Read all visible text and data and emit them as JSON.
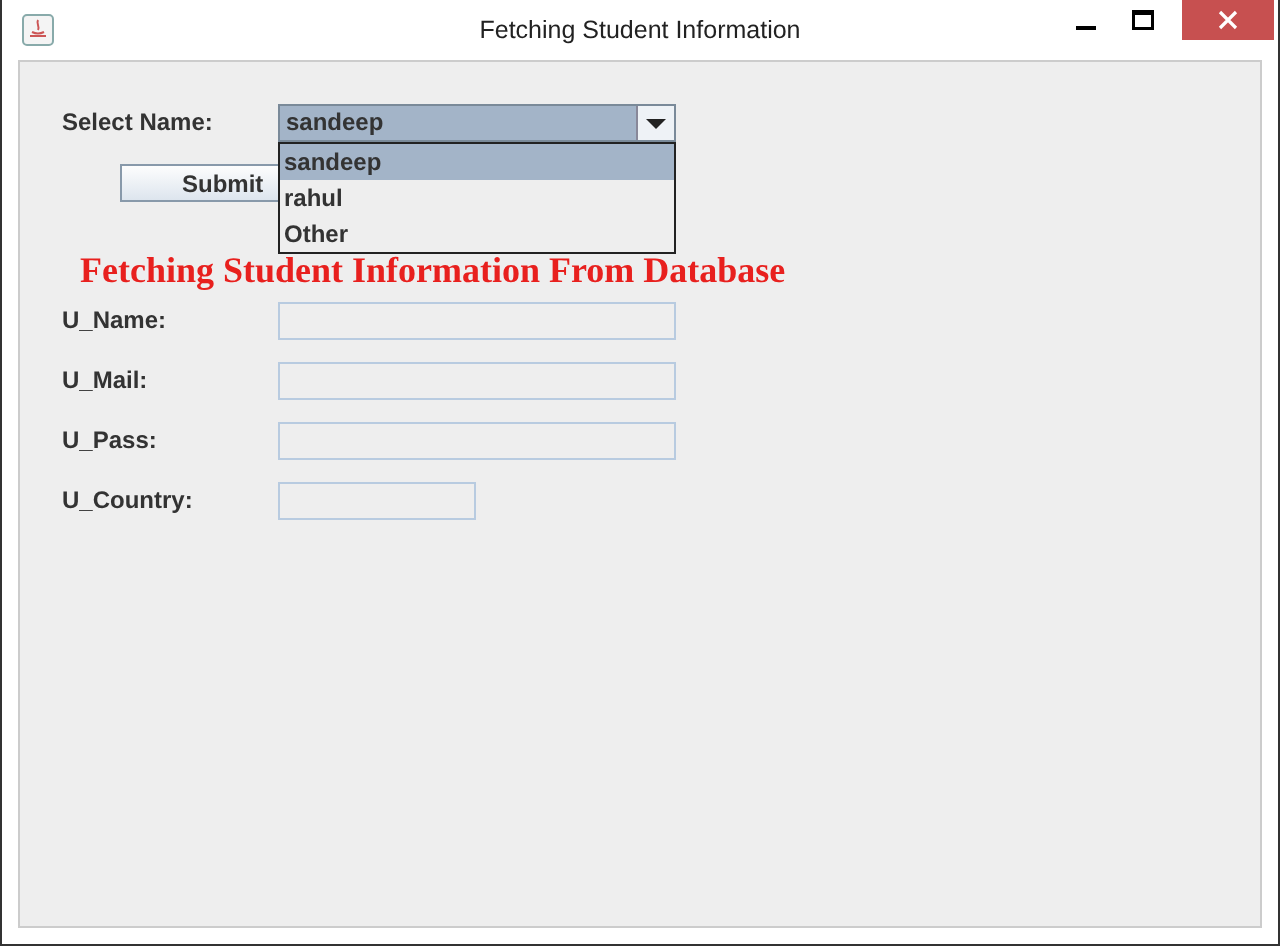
{
  "window": {
    "title": "Fetching Student Information"
  },
  "select": {
    "label": "Select Name:",
    "value": "sandeep",
    "expanded": true,
    "options": [
      {
        "label": "sandeep",
        "selected": true
      },
      {
        "label": "rahul",
        "selected": false
      },
      {
        "label": "Other",
        "selected": false
      }
    ]
  },
  "submit": "Submit",
  "heading": "Fetching Student Information From Database",
  "fields": [
    {
      "label": "U_Name:",
      "kind": "long"
    },
    {
      "label": "U_Mail:",
      "kind": "long"
    },
    {
      "label": "U_Pass:",
      "kind": "long"
    },
    {
      "label": "U_Country:",
      "kind": "short"
    }
  ]
}
